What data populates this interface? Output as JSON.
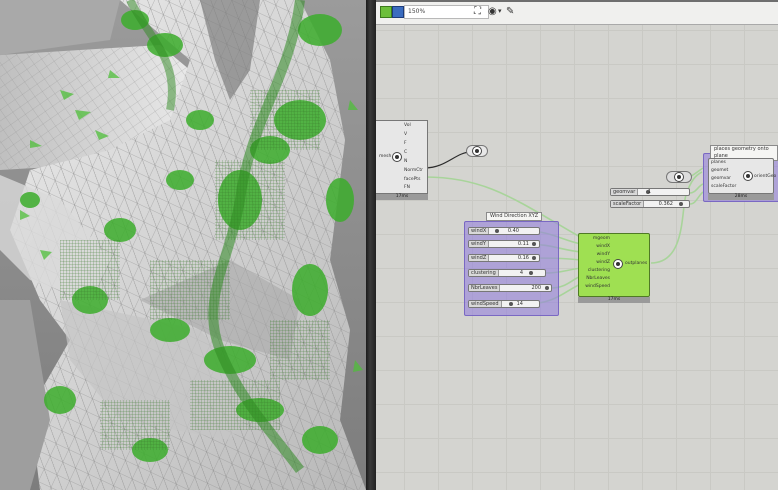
{
  "toolbar": {
    "zoom": "150%",
    "icons": [
      "canvas-icon",
      "save-icon",
      "zoom-extents-icon",
      "preview-eye-icon",
      "sketch-icon"
    ]
  },
  "colors": {
    "canvas": "#d4d4d0",
    "group_fill": "#9682dc",
    "component_green": "#9fe052",
    "wire": "#a8d49a",
    "foliage": "#3cad2c"
  },
  "group_labels": {
    "wind_direction": "Wind Direction XYZ",
    "place_geometry": "places geometry onto plane"
  },
  "left_component": {
    "input_label": "mesh",
    "outputs": [
      "Vol",
      "V",
      "F",
      "C",
      "N",
      "NormCtr",
      "facePts",
      "FN"
    ],
    "timing": "17ms"
  },
  "sliders": [
    {
      "name": "windX",
      "value": "0.40"
    },
    {
      "name": "windY",
      "value": "0.11"
    },
    {
      "name": "windZ",
      "value": "0.16"
    },
    {
      "name": "clustering",
      "value": "4"
    },
    {
      "name": "NbrLeaves",
      "value": "200"
    },
    {
      "name": "windSpeed",
      "value": "14"
    }
  ],
  "main_component": {
    "inputs": [
      "mgeom",
      "windX",
      "windY",
      "windZ",
      "clustering",
      "NbrLeaves",
      "windSpeed"
    ],
    "output": "outplanes",
    "timing": "17ms"
  },
  "right_sliders": [
    {
      "name": "geomvar",
      "value": "1"
    },
    {
      "name": "scaleFactor",
      "value": "0.362"
    }
  ],
  "orient_component": {
    "inputs": [
      "planes",
      "geomet",
      "geomvar",
      "scaleFactor"
    ],
    "output": "orientGeo",
    "timing": "28ms"
  }
}
